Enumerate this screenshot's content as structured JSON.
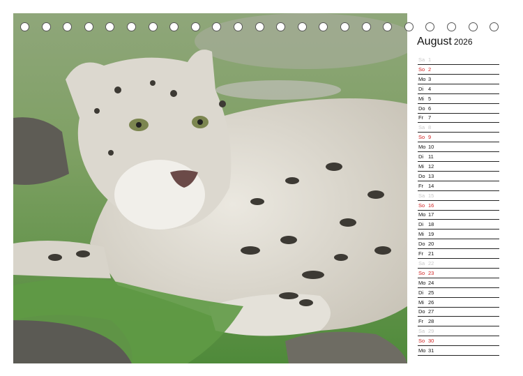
{
  "calendar": {
    "month": "August",
    "year": "2026",
    "days": [
      {
        "wd": "Sa",
        "d": "1",
        "type": "sa"
      },
      {
        "wd": "So",
        "d": "2",
        "type": "so"
      },
      {
        "wd": "Mo",
        "d": "3",
        "type": "wk"
      },
      {
        "wd": "Di",
        "d": "4",
        "type": "wk"
      },
      {
        "wd": "Mi",
        "d": "5",
        "type": "wk"
      },
      {
        "wd": "Do",
        "d": "6",
        "type": "wk"
      },
      {
        "wd": "Fr",
        "d": "7",
        "type": "wk"
      },
      {
        "wd": "Sa",
        "d": "8",
        "type": "sa"
      },
      {
        "wd": "So",
        "d": "9",
        "type": "so"
      },
      {
        "wd": "Mo",
        "d": "10",
        "type": "wk"
      },
      {
        "wd": "Di",
        "d": "11",
        "type": "wk"
      },
      {
        "wd": "Mi",
        "d": "12",
        "type": "wk"
      },
      {
        "wd": "Do",
        "d": "13",
        "type": "wk"
      },
      {
        "wd": "Fr",
        "d": "14",
        "type": "wk"
      },
      {
        "wd": "Sa",
        "d": "15",
        "type": "sa"
      },
      {
        "wd": "So",
        "d": "16",
        "type": "so"
      },
      {
        "wd": "Mo",
        "d": "17",
        "type": "wk"
      },
      {
        "wd": "Di",
        "d": "18",
        "type": "wk"
      },
      {
        "wd": "Mi",
        "d": "19",
        "type": "wk"
      },
      {
        "wd": "Do",
        "d": "20",
        "type": "wk"
      },
      {
        "wd": "Fr",
        "d": "21",
        "type": "wk"
      },
      {
        "wd": "Sa",
        "d": "22",
        "type": "sa"
      },
      {
        "wd": "So",
        "d": "23",
        "type": "so"
      },
      {
        "wd": "Mo",
        "d": "24",
        "type": "wk"
      },
      {
        "wd": "Di",
        "d": "25",
        "type": "wk"
      },
      {
        "wd": "Mi",
        "d": "26",
        "type": "wk"
      },
      {
        "wd": "Do",
        "d": "27",
        "type": "wk"
      },
      {
        "wd": "Fr",
        "d": "28",
        "type": "wk"
      },
      {
        "wd": "Sa",
        "d": "29",
        "type": "sa"
      },
      {
        "wd": "So",
        "d": "30",
        "type": "so"
      },
      {
        "wd": "Mo",
        "d": "31",
        "type": "wk"
      }
    ]
  },
  "colors": {
    "sunday": "#d02020",
    "saturday": "#c8c8c8",
    "weekday": "#111111"
  }
}
